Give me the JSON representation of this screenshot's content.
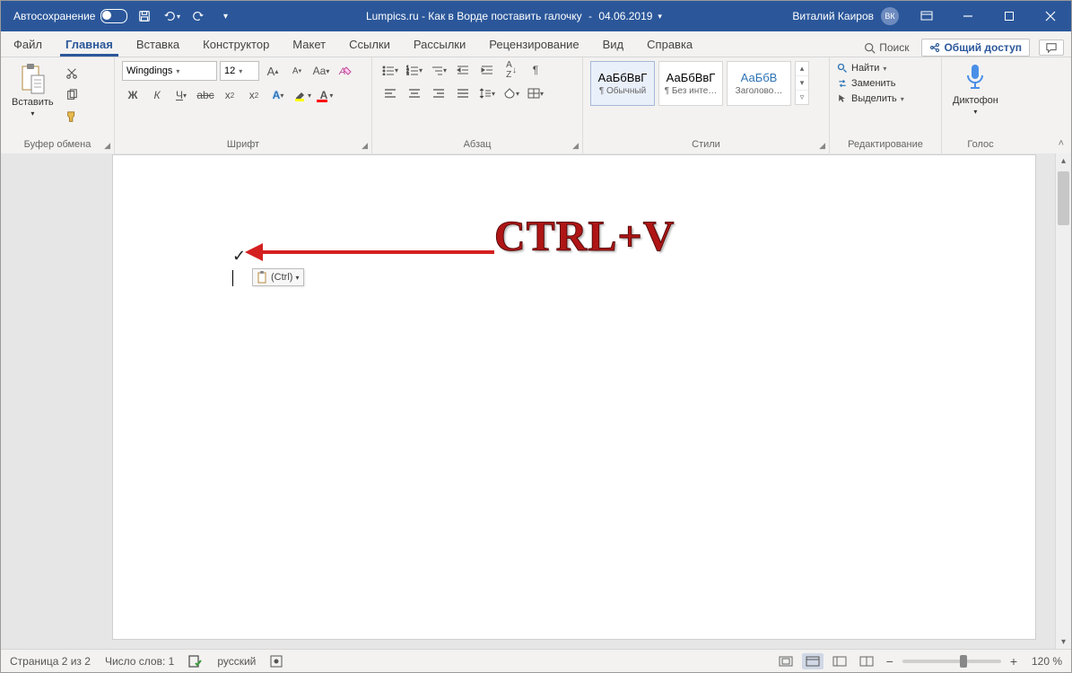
{
  "titlebar": {
    "autosave": "Автосохранение",
    "doc_title": "Lumpics.ru - Как в Ворде поставить галочку",
    "doc_date": "04.06.2019",
    "user_name": "Виталий Каиров",
    "user_initials": "ВК"
  },
  "tabs": {
    "items": [
      "Файл",
      "Главная",
      "Вставка",
      "Конструктор",
      "Макет",
      "Ссылки",
      "Рассылки",
      "Рецензирование",
      "Вид",
      "Справка"
    ],
    "active_index": 1,
    "search_placeholder": "Поиск",
    "share": "Общий доступ"
  },
  "ribbon": {
    "clipboard": {
      "paste": "Вставить",
      "label": "Буфер обмена"
    },
    "font": {
      "name": "Wingdings",
      "size": "12",
      "bold": "Ж",
      "italic": "К",
      "underline": "Ч",
      "strike": "abc",
      "sub": "x₂",
      "sup": "x²",
      "increase": "A",
      "decrease": "A",
      "case": "Aa",
      "clear_icon": "clear-format",
      "text_effects": "A",
      "highlight": "highlight",
      "font_color": "A",
      "label": "Шрифт"
    },
    "paragraph": {
      "label": "Абзац"
    },
    "styles": {
      "items": [
        {
          "sample": "АаБбВвГ",
          "name": "¶ Обычный"
        },
        {
          "sample": "АаБбВвГ",
          "name": "¶ Без инте…"
        },
        {
          "sample": "АаБбВ",
          "name": "Заголово…",
          "blue": true
        }
      ],
      "label": "Стили"
    },
    "editing": {
      "find": "Найти",
      "replace": "Заменить",
      "select": "Выделить",
      "label": "Редактирование"
    },
    "voice": {
      "dictate": "Диктофон",
      "label": "Голос"
    }
  },
  "document": {
    "paste_popup": "(Ctrl)",
    "annotation": "CTRL+V"
  },
  "statusbar": {
    "page": "Страница 2 из 2",
    "words": "Число слов: 1",
    "language": "русский",
    "zoom": "120 %"
  }
}
